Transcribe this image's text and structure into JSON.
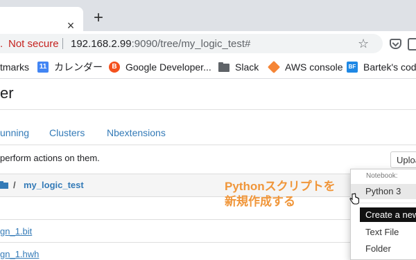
{
  "browser": {
    "new_tab_glyph": "+",
    "close_tab_glyph": "×",
    "security_label": "Not secure",
    "url_host": "192.168.2.99",
    "url_rest": ":9090/tree/my_logic_test#",
    "star_glyph": "☆",
    "bookmarks": [
      {
        "label": "tmarks",
        "icon": "none"
      },
      {
        "label": "カレンダー",
        "icon": "calendar-icon",
        "glyph": "11"
      },
      {
        "label": "Google Developer...",
        "icon": "blogger-icon",
        "glyph": "B"
      },
      {
        "label": "Slack",
        "icon": "folder-icon",
        "glyph": ""
      },
      {
        "label": "AWS console",
        "icon": "aws-icon",
        "glyph": ""
      },
      {
        "label": "Bartek's codin",
        "icon": "bf-icon",
        "glyph": "BF"
      }
    ]
  },
  "jupyter": {
    "title": "er",
    "tabs": [
      "unning",
      "Clusters",
      "Nbextensions"
    ],
    "hint": "perform actions on them.",
    "upload_label": "Uploa",
    "breadcrumb": {
      "separator": "/",
      "folder": "my_logic_test"
    },
    "files": [
      "gn_1.bit",
      "gn_1.hwh"
    ]
  },
  "annotation": {
    "line1": "Pythonスクリプトを",
    "line2": "新規作成する",
    "color": "#f0963a"
  },
  "new_menu": {
    "header": "Notebook:",
    "items": [
      "Python 3",
      "Text File",
      "Folder"
    ],
    "tooltip": "Create a new"
  },
  "colors": {
    "link": "#337ab7",
    "not_secure": "#c5221f",
    "tabstrip": "#dee1e6"
  }
}
